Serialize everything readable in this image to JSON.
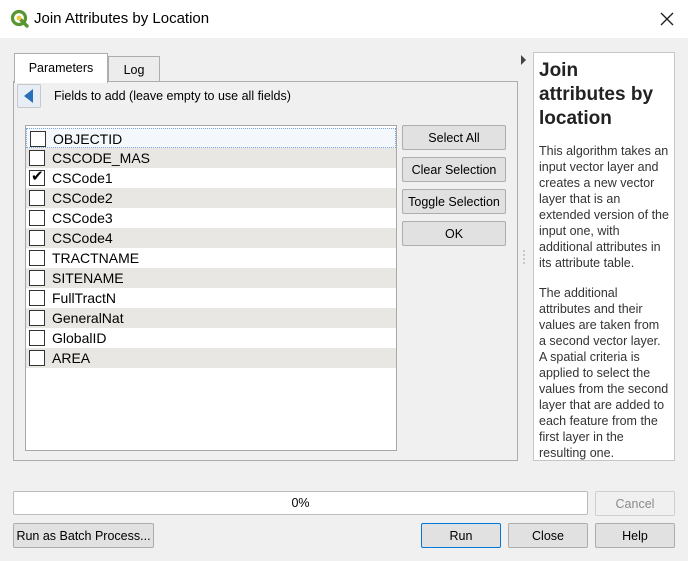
{
  "window": {
    "title": "Join Attributes by Location"
  },
  "tabs": [
    {
      "label": "Parameters"
    },
    {
      "label": "Log"
    }
  ],
  "parameters": {
    "header": "Fields to add (leave empty to use all fields)",
    "fields": [
      {
        "name": "OBJECTID",
        "checked": false
      },
      {
        "name": "CSCODE_MAS",
        "checked": false
      },
      {
        "name": "CSCode1",
        "checked": true
      },
      {
        "name": "CSCode2",
        "checked": false
      },
      {
        "name": "CSCode3",
        "checked": false
      },
      {
        "name": "CSCode4",
        "checked": false
      },
      {
        "name": "TRACTNAME",
        "checked": false
      },
      {
        "name": "SITENAME",
        "checked": false
      },
      {
        "name": "FullTractN",
        "checked": false
      },
      {
        "name": "GeneralNat",
        "checked": false
      },
      {
        "name": "GlobalID",
        "checked": false
      },
      {
        "name": "AREA",
        "checked": false
      }
    ],
    "buttons": {
      "select_all": "Select All",
      "clear_selection": "Clear Selection",
      "toggle_selection": "Toggle Selection",
      "ok": "OK"
    }
  },
  "help": {
    "title": "Join attributes by location",
    "paragraph1": "This algorithm takes an input vector layer and creates a new vector layer that is an extended version of the input one, with additional attributes in its attribute table.",
    "paragraph2": "The additional attributes and their values are taken from a second vector layer. A spatial criteria is applied to select the values from the second layer that are added to each feature from the first layer in the resulting one."
  },
  "progress": {
    "percent_label": "0%",
    "value": 0
  },
  "footer": {
    "cancel": "Cancel",
    "batch": "Run as Batch Process...",
    "run": "Run",
    "close": "Close",
    "help": "Help"
  },
  "colors": {
    "accent": "#0078d7",
    "logo_green": "#589632",
    "logo_yellow": "#f0c93b"
  }
}
